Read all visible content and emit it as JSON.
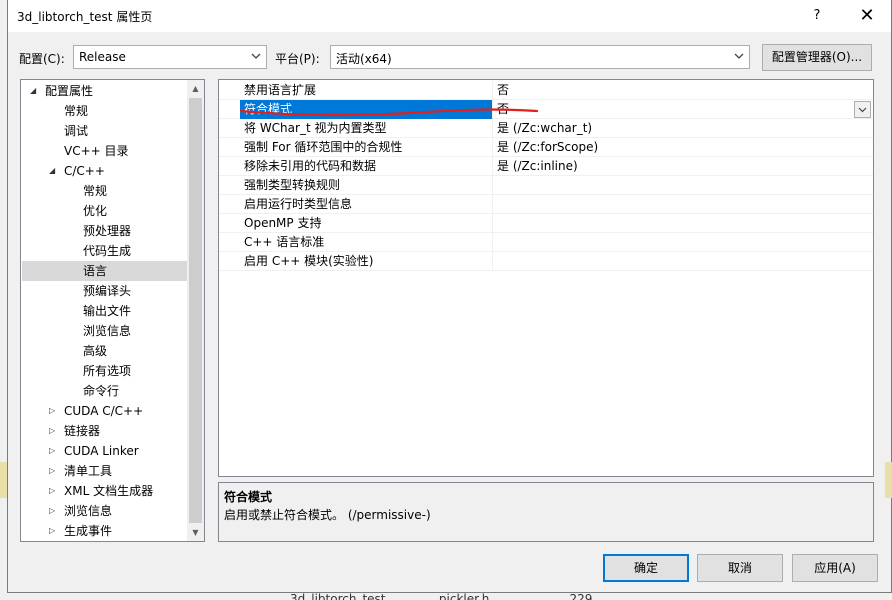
{
  "window": {
    "title": "3d_libtorch_test 属性页",
    "help": "?",
    "close": "✕"
  },
  "config": {
    "label": "配置(C):",
    "value": "Release"
  },
  "platform": {
    "label": "平台(P):",
    "value": "活动(x64)"
  },
  "config_manager_label": "配置管理器(O)...",
  "tree": [
    {
      "label": "配置属性",
      "expander": "◢"
    },
    {
      "label": "常规"
    },
    {
      "label": "调试"
    },
    {
      "label": "VC++ 目录"
    },
    {
      "label": "C/C++",
      "expander": "◢"
    },
    {
      "label": "常规"
    },
    {
      "label": "优化"
    },
    {
      "label": "预处理器"
    },
    {
      "label": "代码生成"
    },
    {
      "label": "语言"
    },
    {
      "label": "预编译头"
    },
    {
      "label": "输出文件"
    },
    {
      "label": "浏览信息"
    },
    {
      "label": "高级"
    },
    {
      "label": "所有选项"
    },
    {
      "label": "命令行"
    },
    {
      "label": "CUDA C/C++",
      "expander": "▷"
    },
    {
      "label": "链接器",
      "expander": "▷"
    },
    {
      "label": "CUDA Linker",
      "expander": "▷"
    },
    {
      "label": "清单工具",
      "expander": "▷"
    },
    {
      "label": "XML 文档生成器",
      "expander": "▷"
    },
    {
      "label": "浏览信息",
      "expander": "▷"
    },
    {
      "label": "生成事件",
      "expander": "▷"
    }
  ],
  "properties": [
    {
      "name": "禁用语言扩展",
      "value": "否"
    },
    {
      "name": "符合模式",
      "value": "否"
    },
    {
      "name": "将 WChar_t 视为内置类型",
      "value": "是 (/Zc:wchar_t)"
    },
    {
      "name": "强制 For 循环范围中的合规性",
      "value": "是 (/Zc:forScope)"
    },
    {
      "name": "移除未引用的代码和数据",
      "value": "是 (/Zc:inline)"
    },
    {
      "name": "强制类型转换规则",
      "value": ""
    },
    {
      "name": "启用运行时类型信息",
      "value": ""
    },
    {
      "name": "OpenMP 支持",
      "value": ""
    },
    {
      "name": "C++ 语言标准",
      "value": ""
    },
    {
      "name": "启用 C++ 模块(实验性)",
      "value": ""
    }
  ],
  "description": {
    "title": "符合模式",
    "text": "启用或禁止符合模式。    (/permissive-)"
  },
  "buttons": {
    "ok": "确定",
    "cancel": "取消",
    "apply": "应用(A)"
  },
  "background_strip": "3d_libtorch_test              pickler.h                     229",
  "colors": {
    "selection": "#0078d7",
    "annotation": "#e0201b"
  }
}
